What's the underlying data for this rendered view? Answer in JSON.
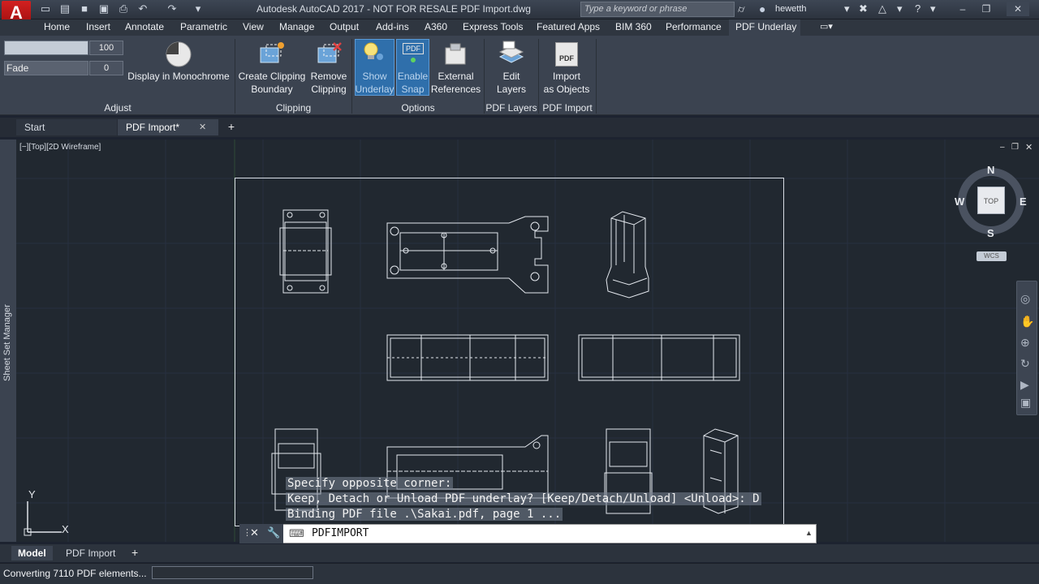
{
  "titlebar": {
    "logo": "A",
    "title": "Autodesk AutoCAD 2017 - NOT FOR RESALE    PDF Import.dwg",
    "search_placeholder": "Type a keyword or phrase",
    "user": "hewetth"
  },
  "tabs": [
    "Home",
    "Insert",
    "Annotate",
    "Parametric",
    "View",
    "Manage",
    "Output",
    "Add-ins",
    "A360",
    "Express Tools",
    "Featured Apps",
    "BIM 360",
    "Performance",
    "PDF Underlay"
  ],
  "ribbon": {
    "contrast_value": "100",
    "fade_label": "Fade",
    "fade_value": "0",
    "monochrome_label": "Display in Monochrome",
    "create_clip_1": "Create Clipping",
    "create_clip_2": "Boundary",
    "remove_clip_1": "Remove",
    "remove_clip_2": "Clipping",
    "show_underlay_1": "Show",
    "show_underlay_2": "Underlay",
    "enable_snap_1": "Enable",
    "enable_snap_2": "Snap",
    "ext_refs_1": "External",
    "ext_refs_2": "References",
    "edit_layers_1": "Edit",
    "edit_layers_2": "Layers",
    "import_1": "Import",
    "import_2": "as Objects",
    "pdf_icon_text": "PDF",
    "panels": {
      "adjust": "Adjust",
      "clipping": "Clipping",
      "options": "Options",
      "pdf_layers": "PDF Layers",
      "pdf_import": "PDF Import"
    }
  },
  "doctabs": {
    "start": "Start",
    "active": "PDF Import*"
  },
  "viewport": {
    "label": "[−][Top][2D Wireframe]",
    "sheet_manager": "Sheet Set Manager",
    "viewcube": {
      "n": "N",
      "s": "S",
      "e": "E",
      "w": "W",
      "top": "TOP",
      "wcs": "WCS"
    },
    "ucs_x": "X",
    "ucs_y": "Y"
  },
  "command": {
    "history": [
      "Specify opposite corner:",
      "Keep, Detach or Unload PDF underlay? [Keep/Detach/Unload] <Unload>: D",
      "Binding PDF file .\\Sakai.pdf, page 1 ..."
    ],
    "current": "PDFIMPORT"
  },
  "layouts": {
    "model": "Model",
    "layout1": "PDF Import"
  },
  "status": {
    "text": "Converting 7110 PDF elements...",
    "progress": 0.0
  }
}
